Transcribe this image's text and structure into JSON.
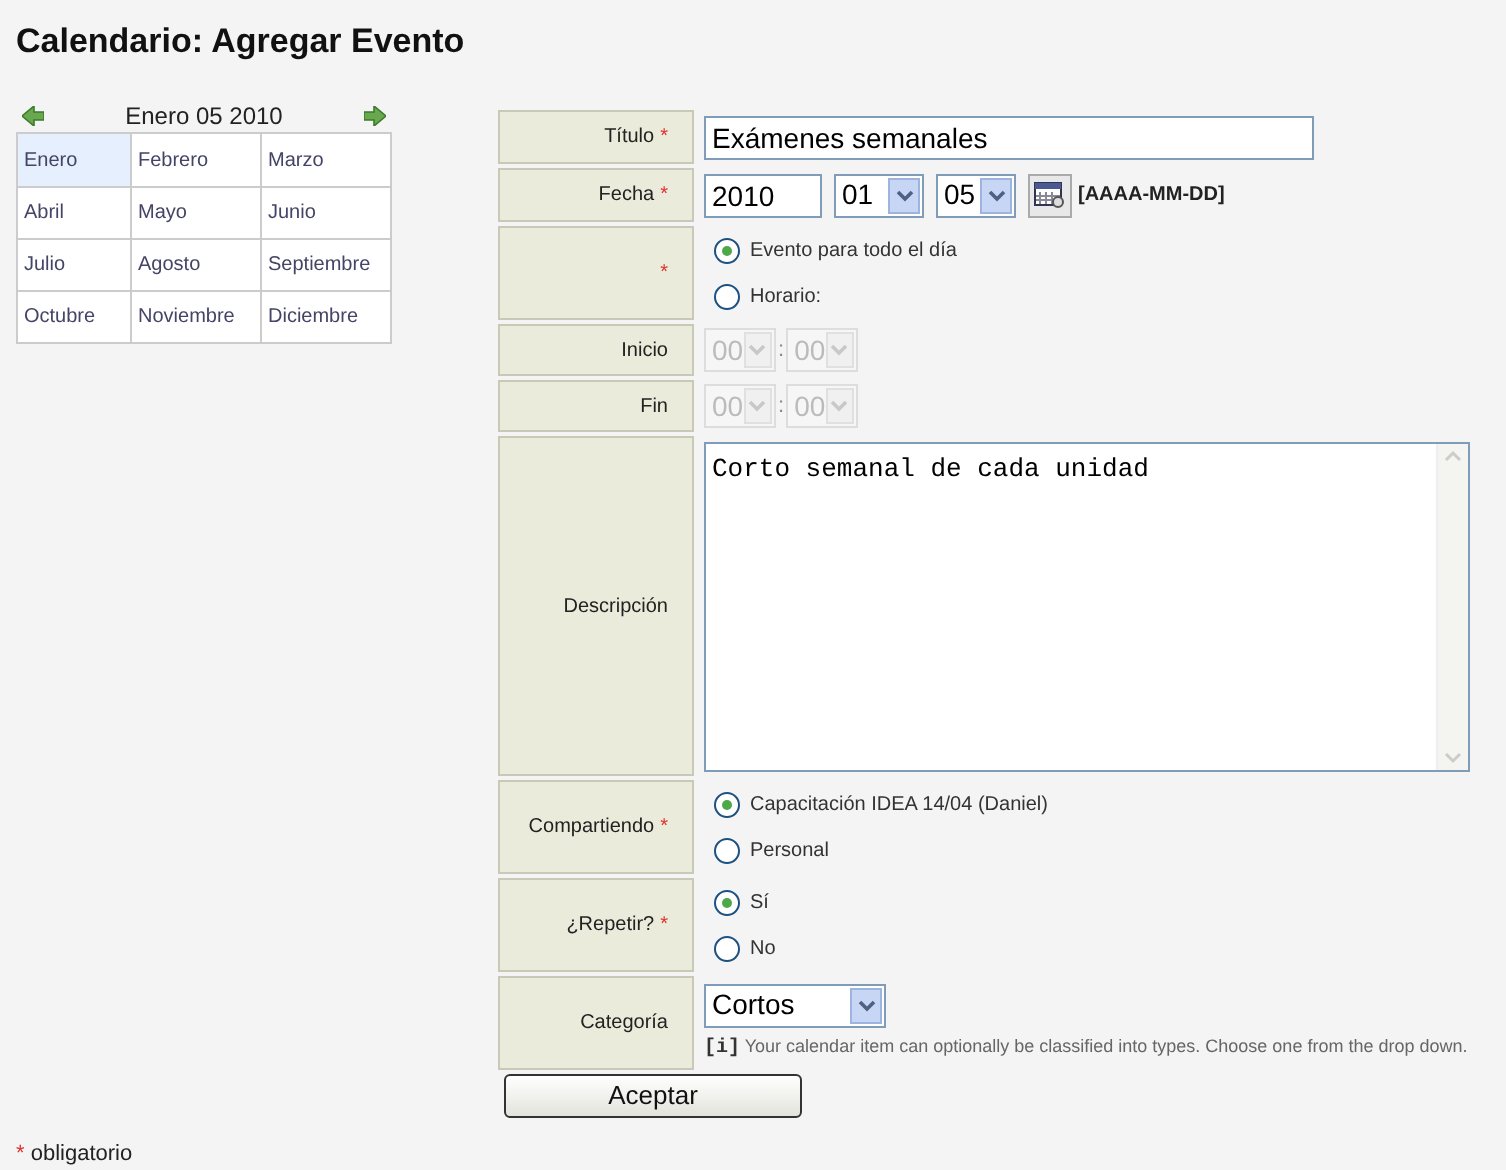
{
  "page_title": "Calendario: Agregar Evento",
  "calendar": {
    "heading": "Enero 05 2010",
    "months": [
      {
        "label": "Enero",
        "selected": true
      },
      {
        "label": "Febrero",
        "selected": false
      },
      {
        "label": "Marzo",
        "selected": false
      },
      {
        "label": "Abril",
        "selected": false
      },
      {
        "label": "Mayo",
        "selected": false
      },
      {
        "label": "Junio",
        "selected": false
      },
      {
        "label": "Julio",
        "selected": false
      },
      {
        "label": "Agosto",
        "selected": false
      },
      {
        "label": "Septiembre",
        "selected": false
      },
      {
        "label": "Octubre",
        "selected": false
      },
      {
        "label": "Noviembre",
        "selected": false
      },
      {
        "label": "Diciembre",
        "selected": false
      }
    ]
  },
  "form": [
    {
      "kind": "text",
      "label": "Título",
      "required_mark": "*",
      "value": "Exámenes semanales"
    },
    {
      "kind": "date",
      "label": "Fecha",
      "required_mark": "*",
      "year": "2010",
      "month": "01",
      "day": "05",
      "format": "[AAAA-MM-DD]"
    },
    {
      "kind": "radio",
      "required_mark": "*",
      "options": [
        {
          "label": "Evento para todo el día",
          "selected": true
        },
        {
          "label": "Horario:",
          "selected": false
        }
      ]
    },
    {
      "kind": "time",
      "label": "Inicio",
      "hour": "00",
      "separator": ":",
      "minute": "00",
      "disabled": true
    },
    {
      "kind": "time",
      "label": "Fin",
      "hour": "00",
      "separator": ":",
      "minute": "00",
      "disabled": true
    },
    {
      "kind": "textarea",
      "label": "Descripción",
      "value": "Corto semanal de cada unidad"
    },
    {
      "kind": "radio",
      "label": "Compartiendo",
      "required_mark": "*",
      "options": [
        {
          "label": "Capacitación IDEA 14/04 (Daniel)",
          "selected": true
        },
        {
          "label": "Personal",
          "selected": false
        }
      ]
    },
    {
      "kind": "radio",
      "label": "¿Repetir?",
      "required_mark": "*",
      "options": [
        {
          "label": "Sí",
          "selected": true
        },
        {
          "label": "No",
          "selected": false
        }
      ]
    },
    {
      "kind": "select",
      "label": "Categoría",
      "value": "Cortos",
      "hint_mark": "[i]",
      "hint": "Your calendar item can optionally be classified into types. Choose one from the drop down."
    }
  ],
  "submit": "Aceptar",
  "footer": {
    "mark": "*",
    "text": "obligatorio"
  }
}
